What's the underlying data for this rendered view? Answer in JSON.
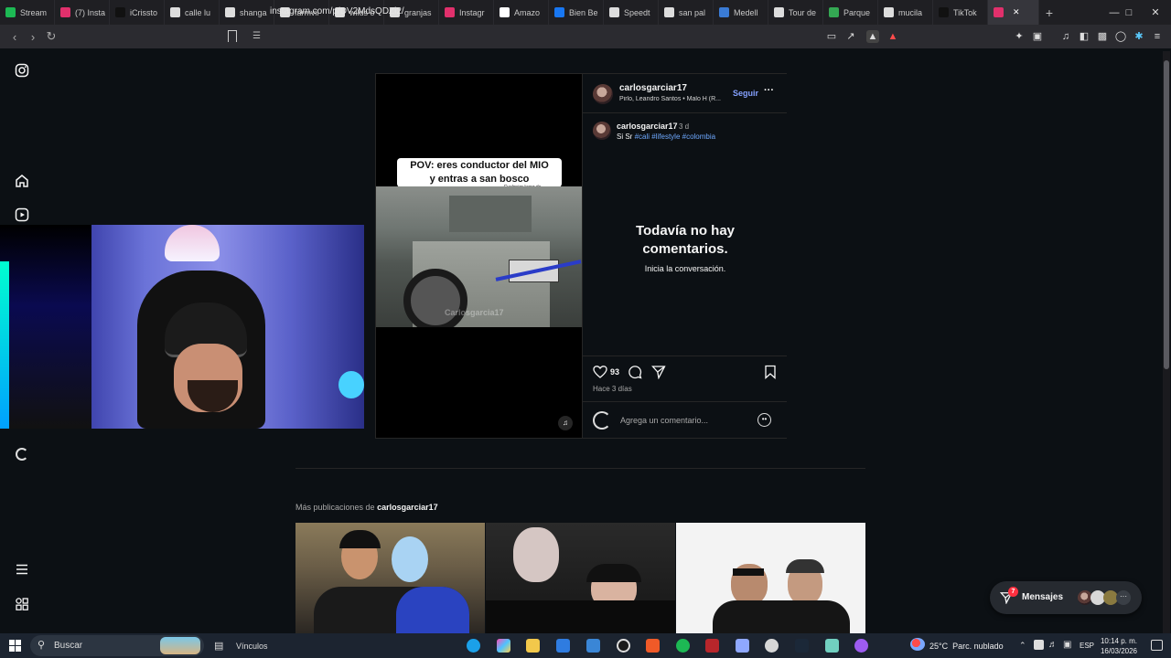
{
  "browser": {
    "tabs": [
      {
        "label": "Stream",
        "color": "#1db954",
        "active": false
      },
      {
        "label": "(7) Insta",
        "color": "#e1306c",
        "active": false
      },
      {
        "label": "iCrissto",
        "color": "#111111",
        "active": false
      },
      {
        "label": "calle lu",
        "color": "#dddddd",
        "active": false
      },
      {
        "label": "shanga",
        "color": "#dddddd",
        "active": false
      },
      {
        "label": "farmvil",
        "color": "#dddddd",
        "active": false
      },
      {
        "label": "wilds o",
        "color": "#dddddd",
        "active": false
      },
      {
        "label": "granjas",
        "color": "#dddddd",
        "active": false
      },
      {
        "label": "Instagr",
        "color": "#e1306c",
        "active": false
      },
      {
        "label": "Amazo",
        "color": "#ffffff",
        "active": false
      },
      {
        "label": "Bien Be",
        "color": "#1877f2",
        "active": false
      },
      {
        "label": "Speedt",
        "color": "#dddddd",
        "active": false
      },
      {
        "label": "san pal",
        "color": "#dddddd",
        "active": false
      },
      {
        "label": "Medell",
        "color": "#3a7bd5",
        "active": false
      },
      {
        "label": "Tour de",
        "color": "#dddddd",
        "active": false
      },
      {
        "label": "Parque",
        "color": "#34a853",
        "active": false
      },
      {
        "label": "mucila",
        "color": "#dddddd",
        "active": false
      },
      {
        "label": "TikTok",
        "color": "#111111",
        "active": false
      },
      {
        "label": "",
        "color": "#e1306c",
        "active": true
      }
    ],
    "new_tab": "+",
    "url": "instagram.com/p/DV2MdsQDZi2/"
  },
  "post": {
    "author": "carlosgarciar17",
    "audio": "Pirlo, Leandro Santos • Malo H (R...",
    "follow_label": "Seguir",
    "more_label": "···",
    "caption_user": "carlosgarciar17",
    "caption_time": "3 d",
    "caption_text": "Si Sr",
    "hashtags": [
      "#cali",
      "#lifestyle",
      "#colombia"
    ],
    "no_comments_title": "Todavía no hay comentarios.",
    "no_comments_sub": "Inicia la conversación.",
    "likes": "93",
    "posted": "Hace 3 días",
    "comment_placeholder": "Agrega un comentario...",
    "video_caption_line1": "POV: eres conductor del MIO",
    "video_caption_line2": "y entras a san bosco",
    "video_sticker": "Cualquier lugar de Cali",
    "video_watermark": "Carlosgarcia17"
  },
  "more_posts": {
    "prefix": "Más publicaciones de",
    "user": "carlosgarciar17"
  },
  "messages": {
    "label": "Mensajes",
    "badge": "7"
  },
  "taskbar": {
    "search_placeholder": "Buscar",
    "links_label": "Vínculos",
    "weather_temp": "25°C",
    "weather_text": "Parc. nublado",
    "lang": "ESP",
    "time": "10:14 p. m.",
    "date": "16/03/2026"
  }
}
